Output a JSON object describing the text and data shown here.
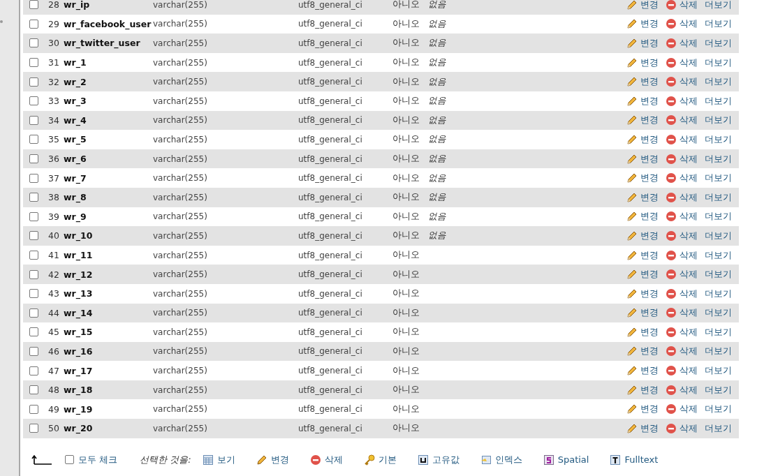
{
  "rows": [
    {
      "num": "28",
      "name": "wr_ip",
      "type": "varchar(255)",
      "collation": "utf8_general_ci",
      "null": "아니오",
      "default": "없음",
      "checked": false,
      "actions": [
        "변경",
        "삭제",
        "더보기"
      ]
    },
    {
      "num": "29",
      "name": "wr_facebook_user",
      "type": "varchar(255)",
      "collation": "utf8_general_ci",
      "null": "아니오",
      "default": "없음",
      "checked": false,
      "actions": [
        "변경",
        "삭제",
        "더보기"
      ]
    },
    {
      "num": "30",
      "name": "wr_twitter_user",
      "type": "varchar(255)",
      "collation": "utf8_general_ci",
      "null": "아니오",
      "default": "없음",
      "checked": false,
      "actions": [
        "변경",
        "삭제",
        "더보기"
      ]
    },
    {
      "num": "31",
      "name": "wr_1",
      "type": "varchar(255)",
      "collation": "utf8_general_ci",
      "null": "아니오",
      "default": "없음",
      "checked": false,
      "actions": [
        "변경",
        "삭제",
        "더보기"
      ]
    },
    {
      "num": "32",
      "name": "wr_2",
      "type": "varchar(255)",
      "collation": "utf8_general_ci",
      "null": "아니오",
      "default": "없음",
      "checked": false,
      "actions": [
        "변경",
        "삭제",
        "더보기"
      ]
    },
    {
      "num": "33",
      "name": "wr_3",
      "type": "varchar(255)",
      "collation": "utf8_general_ci",
      "null": "아니오",
      "default": "없음",
      "checked": false,
      "actions": [
        "변경",
        "삭제",
        "더보기"
      ]
    },
    {
      "num": "34",
      "name": "wr_4",
      "type": "varchar(255)",
      "collation": "utf8_general_ci",
      "null": "아니오",
      "default": "없음",
      "checked": false,
      "actions": [
        "변경",
        "삭제",
        "더보기"
      ]
    },
    {
      "num": "35",
      "name": "wr_5",
      "type": "varchar(255)",
      "collation": "utf8_general_ci",
      "null": "아니오",
      "default": "없음",
      "checked": false,
      "actions": [
        "변경",
        "삭제",
        "더보기"
      ]
    },
    {
      "num": "36",
      "name": "wr_6",
      "type": "varchar(255)",
      "collation": "utf8_general_ci",
      "null": "아니오",
      "default": "없음",
      "checked": false,
      "actions": [
        "변경",
        "삭제",
        "더보기"
      ]
    },
    {
      "num": "37",
      "name": "wr_7",
      "type": "varchar(255)",
      "collation": "utf8_general_ci",
      "null": "아니오",
      "default": "없음",
      "checked": false,
      "actions": [
        "변경",
        "삭제",
        "더보기"
      ]
    },
    {
      "num": "38",
      "name": "wr_8",
      "type": "varchar(255)",
      "collation": "utf8_general_ci",
      "null": "아니오",
      "default": "없음",
      "checked": false,
      "actions": [
        "변경",
        "삭제",
        "더보기"
      ]
    },
    {
      "num": "39",
      "name": "wr_9",
      "type": "varchar(255)",
      "collation": "utf8_general_ci",
      "null": "아니오",
      "default": "없음",
      "checked": false,
      "actions": [
        "변경",
        "삭제",
        "더보기"
      ]
    },
    {
      "num": "40",
      "name": "wr_10",
      "type": "varchar(255)",
      "collation": "utf8_general_ci",
      "null": "아니오",
      "default": "없음",
      "checked": false,
      "actions": [
        "변경",
        "삭제",
        "더보기"
      ]
    },
    {
      "num": "41",
      "name": "wr_11",
      "type": "varchar(255)",
      "collation": "utf8_general_ci",
      "null": "아니오",
      "checked": false,
      "actions": [
        "변경",
        "삭제",
        "더보기"
      ]
    },
    {
      "num": "42",
      "name": "wr_12",
      "type": "varchar(255)",
      "collation": "utf8_general_ci",
      "null": "아니오",
      "checked": false,
      "actions": [
        "변경",
        "삭제",
        "더보기"
      ]
    },
    {
      "num": "43",
      "name": "wr_13",
      "type": "varchar(255)",
      "collation": "utf8_general_ci",
      "null": "아니오",
      "checked": false,
      "actions": [
        "변경",
        "삭제",
        "더보기"
      ]
    },
    {
      "num": "44",
      "name": "wr_14",
      "type": "varchar(255)",
      "collation": "utf8_general_ci",
      "null": "아니오",
      "checked": false,
      "actions": [
        "변경",
        "삭제",
        "더보기"
      ]
    },
    {
      "num": "45",
      "name": "wr_15",
      "type": "varchar(255)",
      "collation": "utf8_general_ci",
      "null": "아니오",
      "checked": false,
      "actions": [
        "변경",
        "삭제",
        "더보기"
      ]
    },
    {
      "num": "46",
      "name": "wr_16",
      "type": "varchar(255)",
      "collation": "utf8_general_ci",
      "null": "아니오",
      "checked": false,
      "actions": [
        "변경",
        "삭제",
        "더보기"
      ]
    },
    {
      "num": "47",
      "name": "wr_17",
      "type": "varchar(255)",
      "collation": "utf8_general_ci",
      "null": "아니오",
      "checked": false,
      "actions": [
        "변경",
        "삭제",
        "더보기"
      ]
    },
    {
      "num": "48",
      "name": "wr_18",
      "type": "varchar(255)",
      "collation": "utf8_general_ci",
      "null": "아니오",
      "checked": false,
      "actions": [
        "변경",
        "삭제",
        "더보기"
      ]
    },
    {
      "num": "49",
      "name": "wr_19",
      "type": "varchar(255)",
      "collation": "utf8_general_ci",
      "null": "아니오",
      "checked": false,
      "actions": [
        "변경",
        "삭제",
        "더보기"
      ]
    },
    {
      "num": "50",
      "name": "wr_20",
      "type": "varchar(255)",
      "collation": "utf8_general_ci",
      "null": "아니오",
      "checked": false,
      "actions": [
        "변경",
        "삭제",
        "더보기"
      ]
    }
  ],
  "footer": {
    "check_all": {
      "label": "모두 체크",
      "checked": false
    },
    "with_selected": "선택한 것을:",
    "actions": [
      {
        "kind": "browse",
        "label": "보기"
      },
      {
        "kind": "change",
        "label": "변경"
      },
      {
        "kind": "drop",
        "label": "삭제"
      },
      {
        "kind": "primary",
        "label": "기본"
      },
      {
        "kind": "unique",
        "label": "고유값"
      },
      {
        "kind": "index",
        "label": "인덱스"
      },
      {
        "kind": "spatial",
        "label": "Spatial"
      },
      {
        "kind": "fulltext",
        "label": "Fulltext"
      }
    ]
  }
}
